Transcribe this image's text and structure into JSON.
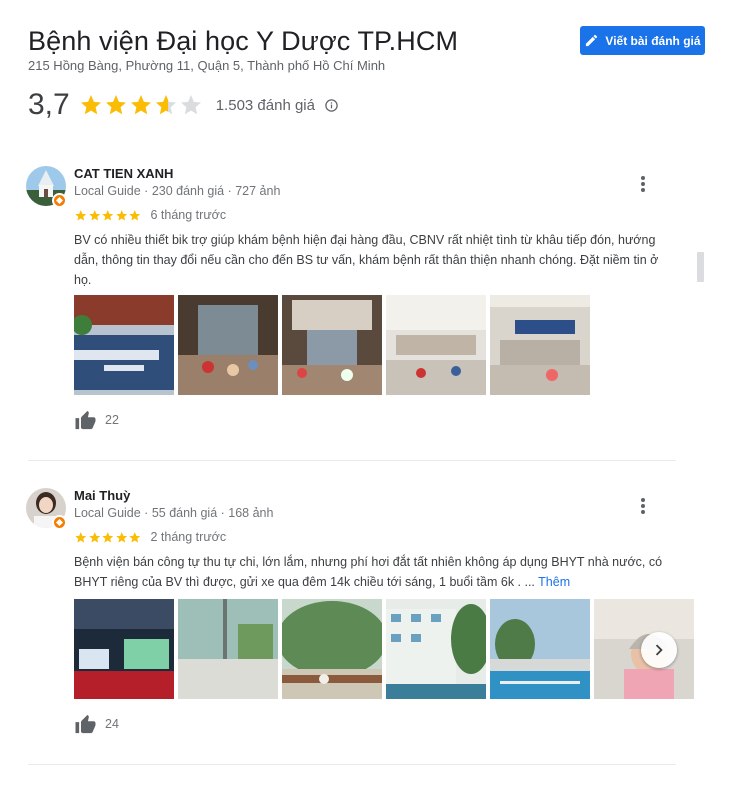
{
  "place": {
    "title": "Bệnh viện Đại học Y Dược TP.HCM",
    "address": "215 Hồng Bàng, Phường 11, Quận 5, Thành phố Hồ Chí Minh",
    "write_review_label": "Viết bài đánh giá",
    "rating": "3,7",
    "rating_value": 3.7,
    "review_count": "1.503 đánh giá"
  },
  "colors": {
    "accent": "#1a73e8",
    "star": "#fbbc04",
    "star_empty": "#dadce0",
    "badge": "#f57c00"
  },
  "reviews": [
    {
      "name": "CAT TIEN XANH",
      "meta": "Local Guide · 230 đánh giá · 727 ảnh",
      "stars": 5,
      "date": "6 tháng trước",
      "text": "BV có nhiều thiết bik trợ giúp khám bệnh hiện đại hàng đầu, CBNV rất nhiệt tình từ khâu tiếp đón, hướng dẫn, thông tin thay đổi nếu cần cho đến BS tư vấn, khám bệnh rất thân thiện nhanh chóng. Đặt niềm tin ở họ.",
      "likes": "22",
      "photo_count": 5
    },
    {
      "name": "Mai Thuỳ",
      "meta": "Local Guide · 55 đánh giá · 168 ảnh",
      "stars": 5,
      "date": "2 tháng trước",
      "text": "Bệnh viện bán công tự thu tự chi,  lớn lắm, nhưng phí hơi đắt tất nhiên không áp dụng BHYT nhà nước, có BHYT riêng của BV thì được, gửi xe qua đêm 14k chiều tới sáng, 1 buổi tầm 6k . ...",
      "more_label": "Thêm",
      "likes": "24",
      "photo_count": 6
    }
  ],
  "icons": {
    "write": "pencil-icon",
    "info": "info-icon",
    "more": "more-vert-icon",
    "like": "thumbs-up-icon",
    "next": "chevron-right-icon"
  }
}
